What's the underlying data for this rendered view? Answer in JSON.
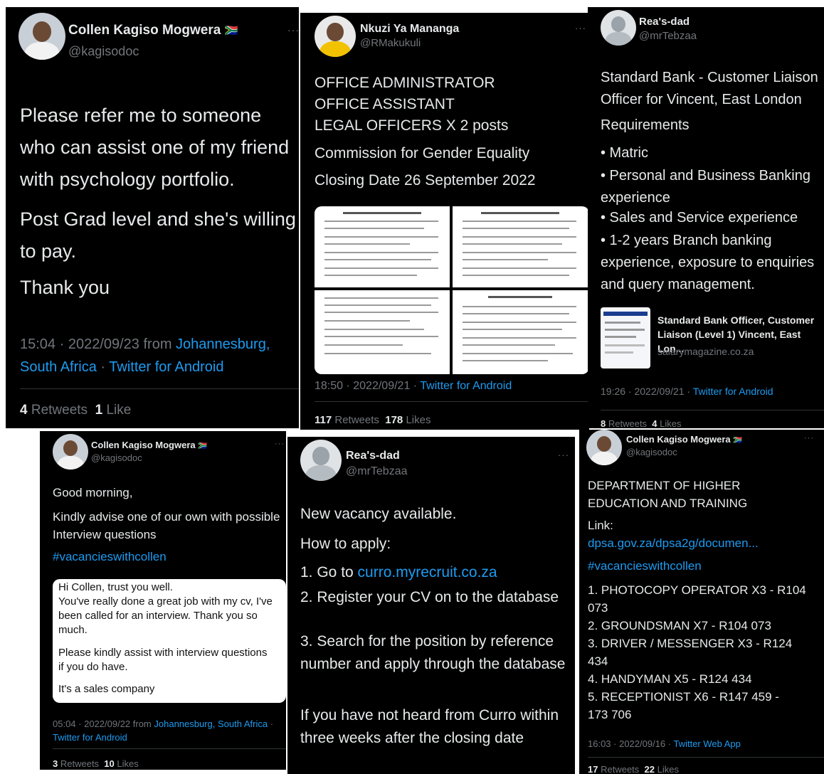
{
  "tweet1": {
    "name": "Collen Kagiso Mogwera",
    "flag": "🇿🇦",
    "handle": "@kagisodoc",
    "more": "···",
    "para1": "Please refer me to someone who can assist one of my friend with psychology portfolio.",
    "para2": "Post Grad level and she's willing to pay.",
    "para3": "Thank you",
    "time": "15:04 · 2022/09/23 from ",
    "location": "Johannesburg, South Africa",
    "sep": " · ",
    "client": "Twitter for Android",
    "retweets_count": "4",
    "retweets_label": "Retweets",
    "likes_count": "1",
    "likes_label": "Like"
  },
  "tweet2": {
    "name": "Nkuzi Ya Mananga",
    "handle": "@RMakukuli",
    "more": "···",
    "line1": "OFFICE ADMINISTRATOR",
    "line2": "OFFICE ASSISTANT",
    "line3": "LEGAL OFFICERS X 2 posts",
    "line4": "Commission for Gender Equality",
    "line5": "Closing Date 26 September 2022",
    "time": "18:50 · 2022/09/21 · ",
    "client": "Twitter for Android",
    "retweets_count": "117",
    "retweets_label": "Retweets",
    "likes_count": "178",
    "likes_label": "Likes"
  },
  "tweet3": {
    "name": "Rea's-dad",
    "handle": "@mrTebzaa",
    "title": "Standard Bank - Customer Liaison Officer for  Vincent, East London",
    "requirements": "Requirements",
    "req1": "• Matric",
    "req2": "• Personal and Business Banking experience",
    "req3": "• Sales and Service experience",
    "req4": "• 1-2 years Branch banking experience, exposure to enquiries and query management.",
    "card_title": "Standard Bank Officer, Customer Liaison (Level 1) Vincent, East Lon...",
    "card_domain": "salarymagazine.co.za",
    "time": "19:26 · 2022/09/21 · ",
    "client": "Twitter for Android",
    "retweets_count": "8",
    "retweets_label": "Retweets",
    "likes_count": "4",
    "likes_label": "Likes"
  },
  "tweet4": {
    "name": "Collen Kagiso Mogwera",
    "flag": "🇿🇦",
    "handle": "@kagisodoc",
    "more": "···",
    "line1": "Good morning,",
    "line2": "Kindly advise one of our own with possible Interview questions",
    "hashtag": "#vacancieswithcollen",
    "quote1": "Hi Collen, trust you well.\nYou've really done a great job with my cv, I've been called for an interview. Thank you so much.",
    "quote2": "Please kindly assist with interview questions if you do have.",
    "quote3": "It's a sales company",
    "time": "05:04 · 2022/09/22 from ",
    "location": "Johannesburg, South Africa",
    "sep": " · ",
    "client": "Twitter for Android",
    "retweets_count": "3",
    "retweets_label": "Retweets",
    "likes_count": "10",
    "likes_label": "Likes"
  },
  "tweet5": {
    "name": "Rea's-dad",
    "handle": "@mrTebzaa",
    "more": "···",
    "line1": "New vacancy available.",
    "line2": "How to apply:",
    "step1_prefix": "1. Go to ",
    "step1_link": "curro.myrecruit.co.za",
    "step2": "2. Register your CV on to the database",
    "step3": "3. Search for the position by reference number and apply through the database",
    "line3": "If you have not heard from Curro within three weeks after the closing date"
  },
  "tweet6": {
    "name": "Collen Kagiso Mogwera",
    "flag": "🇿🇦",
    "handle": "@kagisodoc",
    "more": "···",
    "line1": "DEPARTMENT OF HIGHER EDUCATION AND TRAINING",
    "line2": "Link:",
    "link": "dpsa.gov.za/dpsa2g/documen...",
    "hashtag": "#vacancieswithcollen",
    "item1": "1. PHOTOCOPY OPERATOR X3 - R104 073",
    "item2": "2. GROUNDSMAN X7 - R104 073",
    "item3": "3. DRIVER / MESSENGER X3 - R124 434",
    "item4": "4. HANDYMAN X5 - R124 434",
    "item5": "5. RECEPTIONIST X6 - R147 459 - 173 706",
    "time": "16:03 · 2022/09/16 · ",
    "client": "Twitter Web App",
    "retweets_count": "17",
    "retweets_label": "Retweets",
    "likes_count": "22",
    "likes_label": "Likes"
  },
  "colors": {
    "background": "#000000",
    "text": "#e7e9ea",
    "muted": "#71767b",
    "link": "#1d9bf0"
  }
}
